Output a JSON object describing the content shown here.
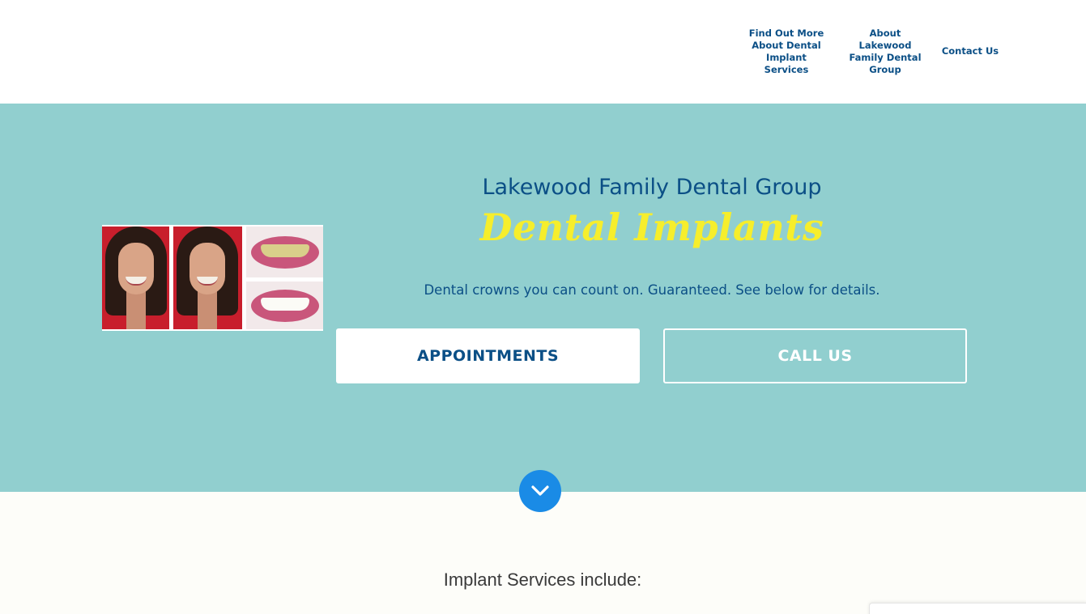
{
  "nav": {
    "items": [
      {
        "label": "Find Out More About Dental Implant Services"
      },
      {
        "label": "About Lakewood Family Dental Group"
      },
      {
        "label": "Contact Us"
      }
    ]
  },
  "hero": {
    "title": "Lakewood Family Dental Group",
    "script_title": "Dental Implants",
    "subtitle": "Dental crowns you can count on. Guaranteed. See below for details.",
    "buttons": {
      "appointments": "APPOINTMENTS",
      "call": "CALL US"
    }
  },
  "scroll_icon": "chevron-down-icon",
  "section": {
    "heading": "Implant Services include:"
  },
  "colors": {
    "hero_bg": "#91cfcf",
    "brand_blue": "#0b4f86",
    "script_yellow": "#f6ee2c",
    "scroll_button": "#1a8be6"
  }
}
